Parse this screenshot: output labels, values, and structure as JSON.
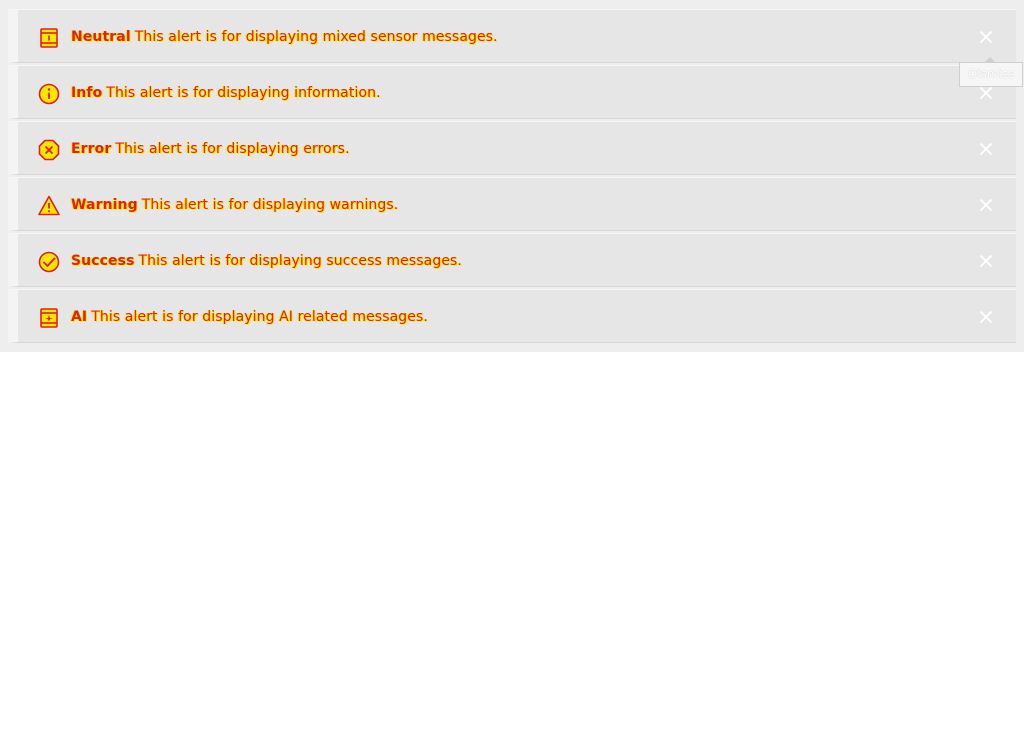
{
  "alerts": [
    {
      "title": "Neutral",
      "message": "This alert is for displaying mixed sensor messages.",
      "icon": "neutral-icon",
      "dismiss_icon": "close-icon"
    },
    {
      "title": "Info",
      "message": "This alert is for displaying information.",
      "icon": "info-icon",
      "dismiss_icon": "close-icon"
    },
    {
      "title": "Error",
      "message": "This alert is for displaying errors.",
      "icon": "error-icon",
      "dismiss_icon": "close-icon"
    },
    {
      "title": "Warning",
      "message": "This alert is for displaying warnings.",
      "icon": "warning-icon",
      "dismiss_icon": "close-icon"
    },
    {
      "title": "Success",
      "message": "This alert is for displaying success messages.",
      "icon": "success-icon",
      "dismiss_icon": "close-icon"
    },
    {
      "title": "AI",
      "message": "This alert is for displaying AI related messages.",
      "icon": "ai-icon",
      "dismiss_icon": "close-icon"
    }
  ],
  "tooltip": {
    "text": "Dismiss"
  },
  "colors": {
    "panel_background": "#eeeeee",
    "alert_background": "#e6e6e6",
    "text": "#e02020",
    "text_outline": "#ffe600",
    "icon_stroke": "#e02020",
    "icon_fill": "#ffe600",
    "dismiss_icon": "#ffffff"
  }
}
